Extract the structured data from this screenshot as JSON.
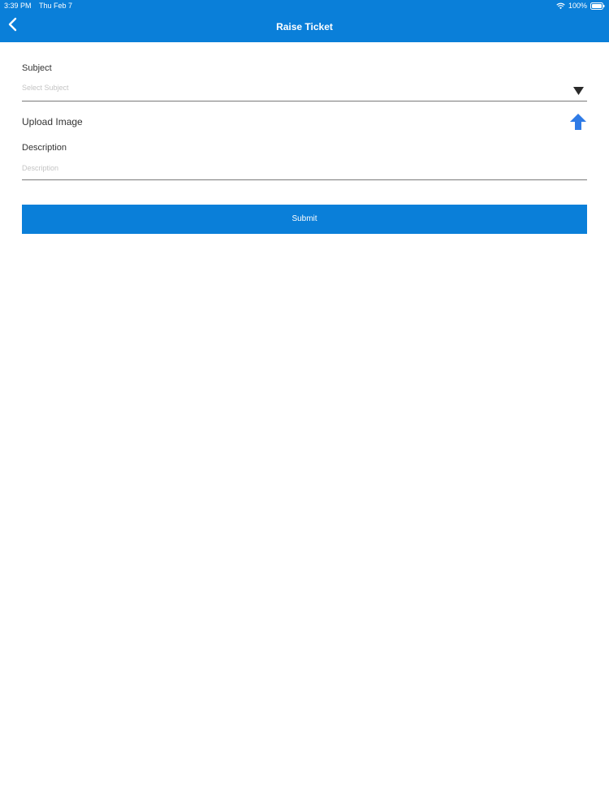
{
  "status_bar": {
    "time": "3:39 PM",
    "date": "Thu Feb 7",
    "battery": "100%"
  },
  "nav": {
    "title": "Raise Ticket",
    "back_icon": "chevron-left-icon"
  },
  "form": {
    "subject": {
      "label": "Subject",
      "placeholder": "Select Subject",
      "icon": "triangle-down-icon"
    },
    "upload": {
      "label": "Upload Image",
      "icon": "arrow-up-icon"
    },
    "description": {
      "label": "Description",
      "placeholder": "Description"
    },
    "submit_label": "Submit"
  },
  "colors": {
    "primary": "#0a7fd9",
    "upload_icon": "#2f7be6",
    "label_text": "#333333",
    "placeholder_text": "#c4c4c4"
  }
}
